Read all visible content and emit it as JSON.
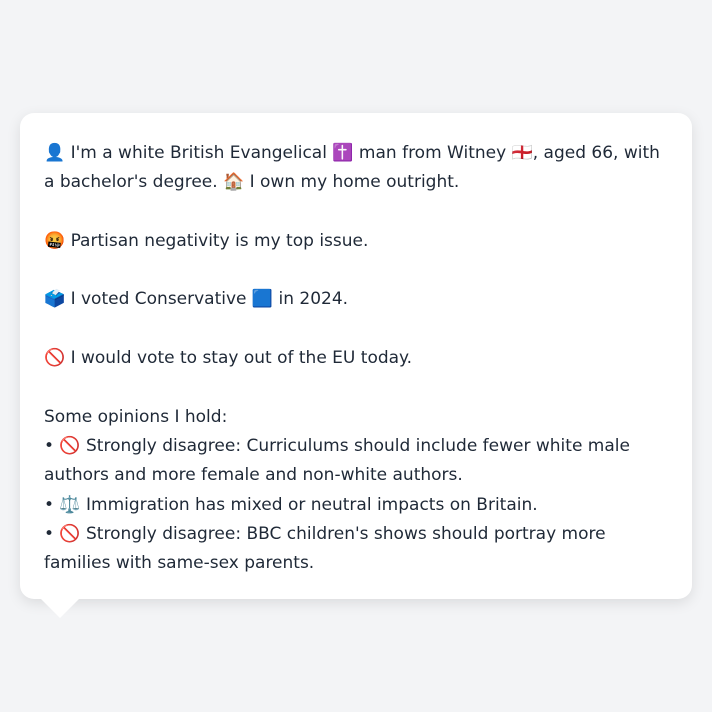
{
  "profile": {
    "intro": "👤 I'm a white British Evangelical ✝️ man from Witney 🏴󠁧󠁢󠁥󠁮󠁧󠁿, aged 66, with a bachelor's degree. 🏠 I own my home outright.",
    "top_issue": "🤬 Partisan negativity is my top issue.",
    "vote_2024": "🗳️ I voted Conservative 🟦 in 2024.",
    "eu": "🚫 I would vote to stay out of the EU today.",
    "opinions_heading": "Some opinions I hold:",
    "opinions": [
      "• 🚫 Strongly disagree: Curriculums should include fewer white male authors and more female and non-white authors.",
      "• ⚖️ Immigration has mixed or neutral impacts on Britain.",
      "• 🚫 Strongly disagree: BBC children's shows should portray more families with same-sex parents."
    ]
  }
}
